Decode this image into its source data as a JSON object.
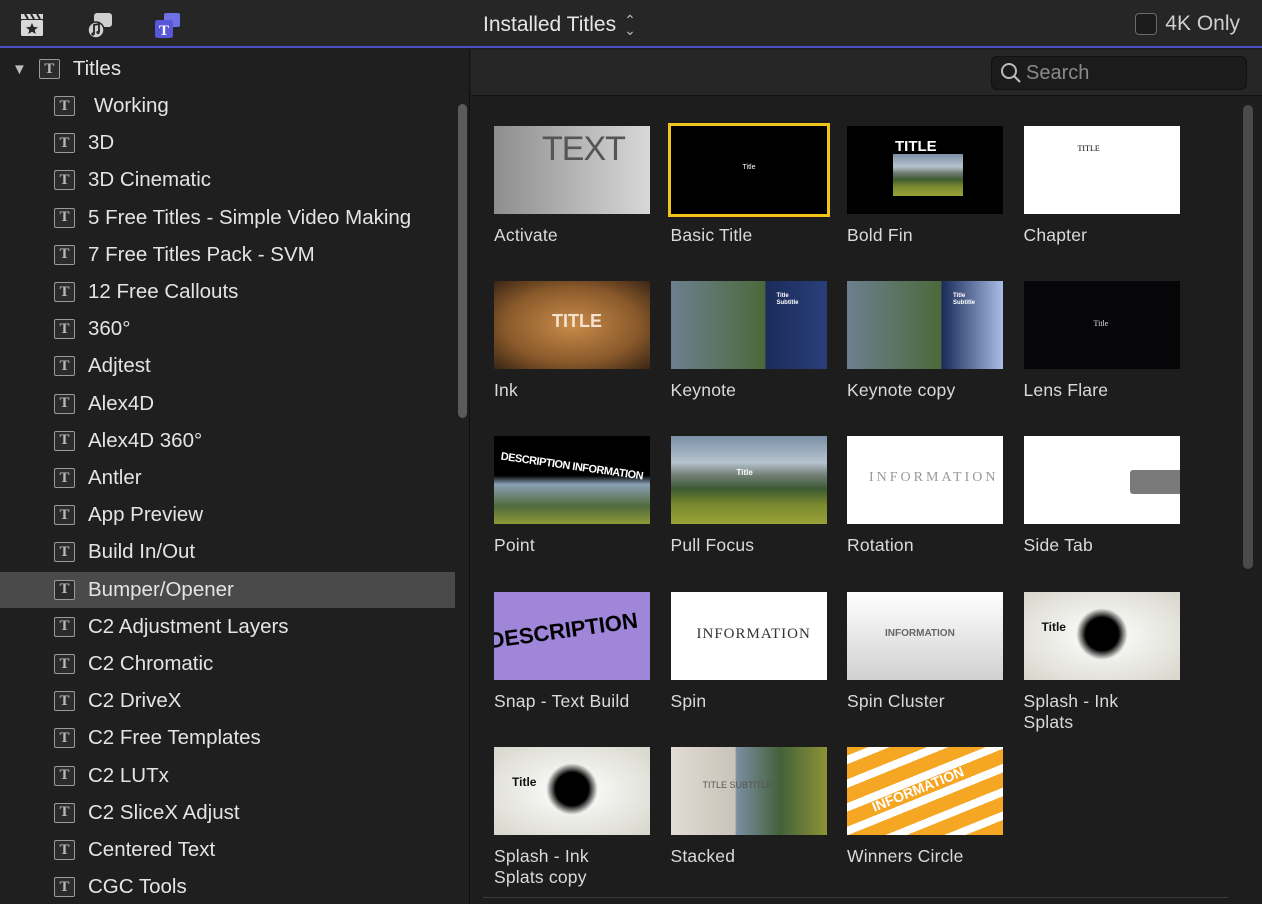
{
  "toolbar": {
    "icons": [
      "clapper-star-icon",
      "photos-music-icon",
      "titles-generators-icon"
    ],
    "popup_label": "Installed Titles",
    "k4_label": "4K Only",
    "accent": "#4b4fc4"
  },
  "sidebar": {
    "root_label": "Titles",
    "items": [
      {
        "label": "Working"
      },
      {
        "label": "3D"
      },
      {
        "label": "3D Cinematic"
      },
      {
        "label": "5 Free Titles - Simple Video Making"
      },
      {
        "label": "7 Free Titles Pack - SVM"
      },
      {
        "label": "12 Free Callouts"
      },
      {
        "label": "360°"
      },
      {
        "label": "Adjtest"
      },
      {
        "label": "Alex4D"
      },
      {
        "label": "Alex4D 360°"
      },
      {
        "label": "Antler"
      },
      {
        "label": "App Preview"
      },
      {
        "label": "Build In/Out"
      },
      {
        "label": "Bumper/Opener"
      },
      {
        "label": "C2 Adjustment Layers"
      },
      {
        "label": "C2 Chromatic"
      },
      {
        "label": "C2 DriveX"
      },
      {
        "label": "C2 Free Templates"
      },
      {
        "label": "C2 LUTx"
      },
      {
        "label": "C2 SliceX Adjust"
      },
      {
        "label": "Centered Text"
      },
      {
        "label": "CGC Tools"
      }
    ],
    "selected": "Bumper/Opener"
  },
  "search": {
    "placeholder": "Search",
    "value": ""
  },
  "tiles": [
    {
      "label": "Activate",
      "thumb_text": "TEXT"
    },
    {
      "label": "Basic Title",
      "thumb_text": "Title",
      "selected": true
    },
    {
      "label": "Bold Fin",
      "thumb_text": "TITLE"
    },
    {
      "label": "Chapter",
      "thumb_text": "TITLE"
    },
    {
      "label": "Ink",
      "thumb_text": "TITLE"
    },
    {
      "label": "Keynote",
      "thumb_text": "Title Subtitle"
    },
    {
      "label": "Keynote copy",
      "thumb_text": "Title Subtitle"
    },
    {
      "label": "Lens Flare",
      "thumb_text": "Title"
    },
    {
      "label": "Point",
      "thumb_text": "DESCRIPTION INFORMATION"
    },
    {
      "label": "Pull Focus",
      "thumb_text": "Title"
    },
    {
      "label": "Rotation",
      "thumb_text": "INFORMATION"
    },
    {
      "label": "Side Tab",
      "thumb_text": ""
    },
    {
      "label": "Snap - Text Build",
      "thumb_text": "DESCRIPTION"
    },
    {
      "label": "Spin",
      "thumb_text": "INFORMATION"
    },
    {
      "label": "Spin Cluster",
      "thumb_text": "INFORMATION"
    },
    {
      "label": "Splash - Ink Splats",
      "thumb_text": "Title"
    },
    {
      "label": "Splash - Ink Splats copy",
      "thumb_text": "Title"
    },
    {
      "label": "Stacked",
      "thumb_text": "TITLE SUBTITLE"
    },
    {
      "label": "Winners Circle",
      "thumb_text": "INFORMATION"
    }
  ]
}
